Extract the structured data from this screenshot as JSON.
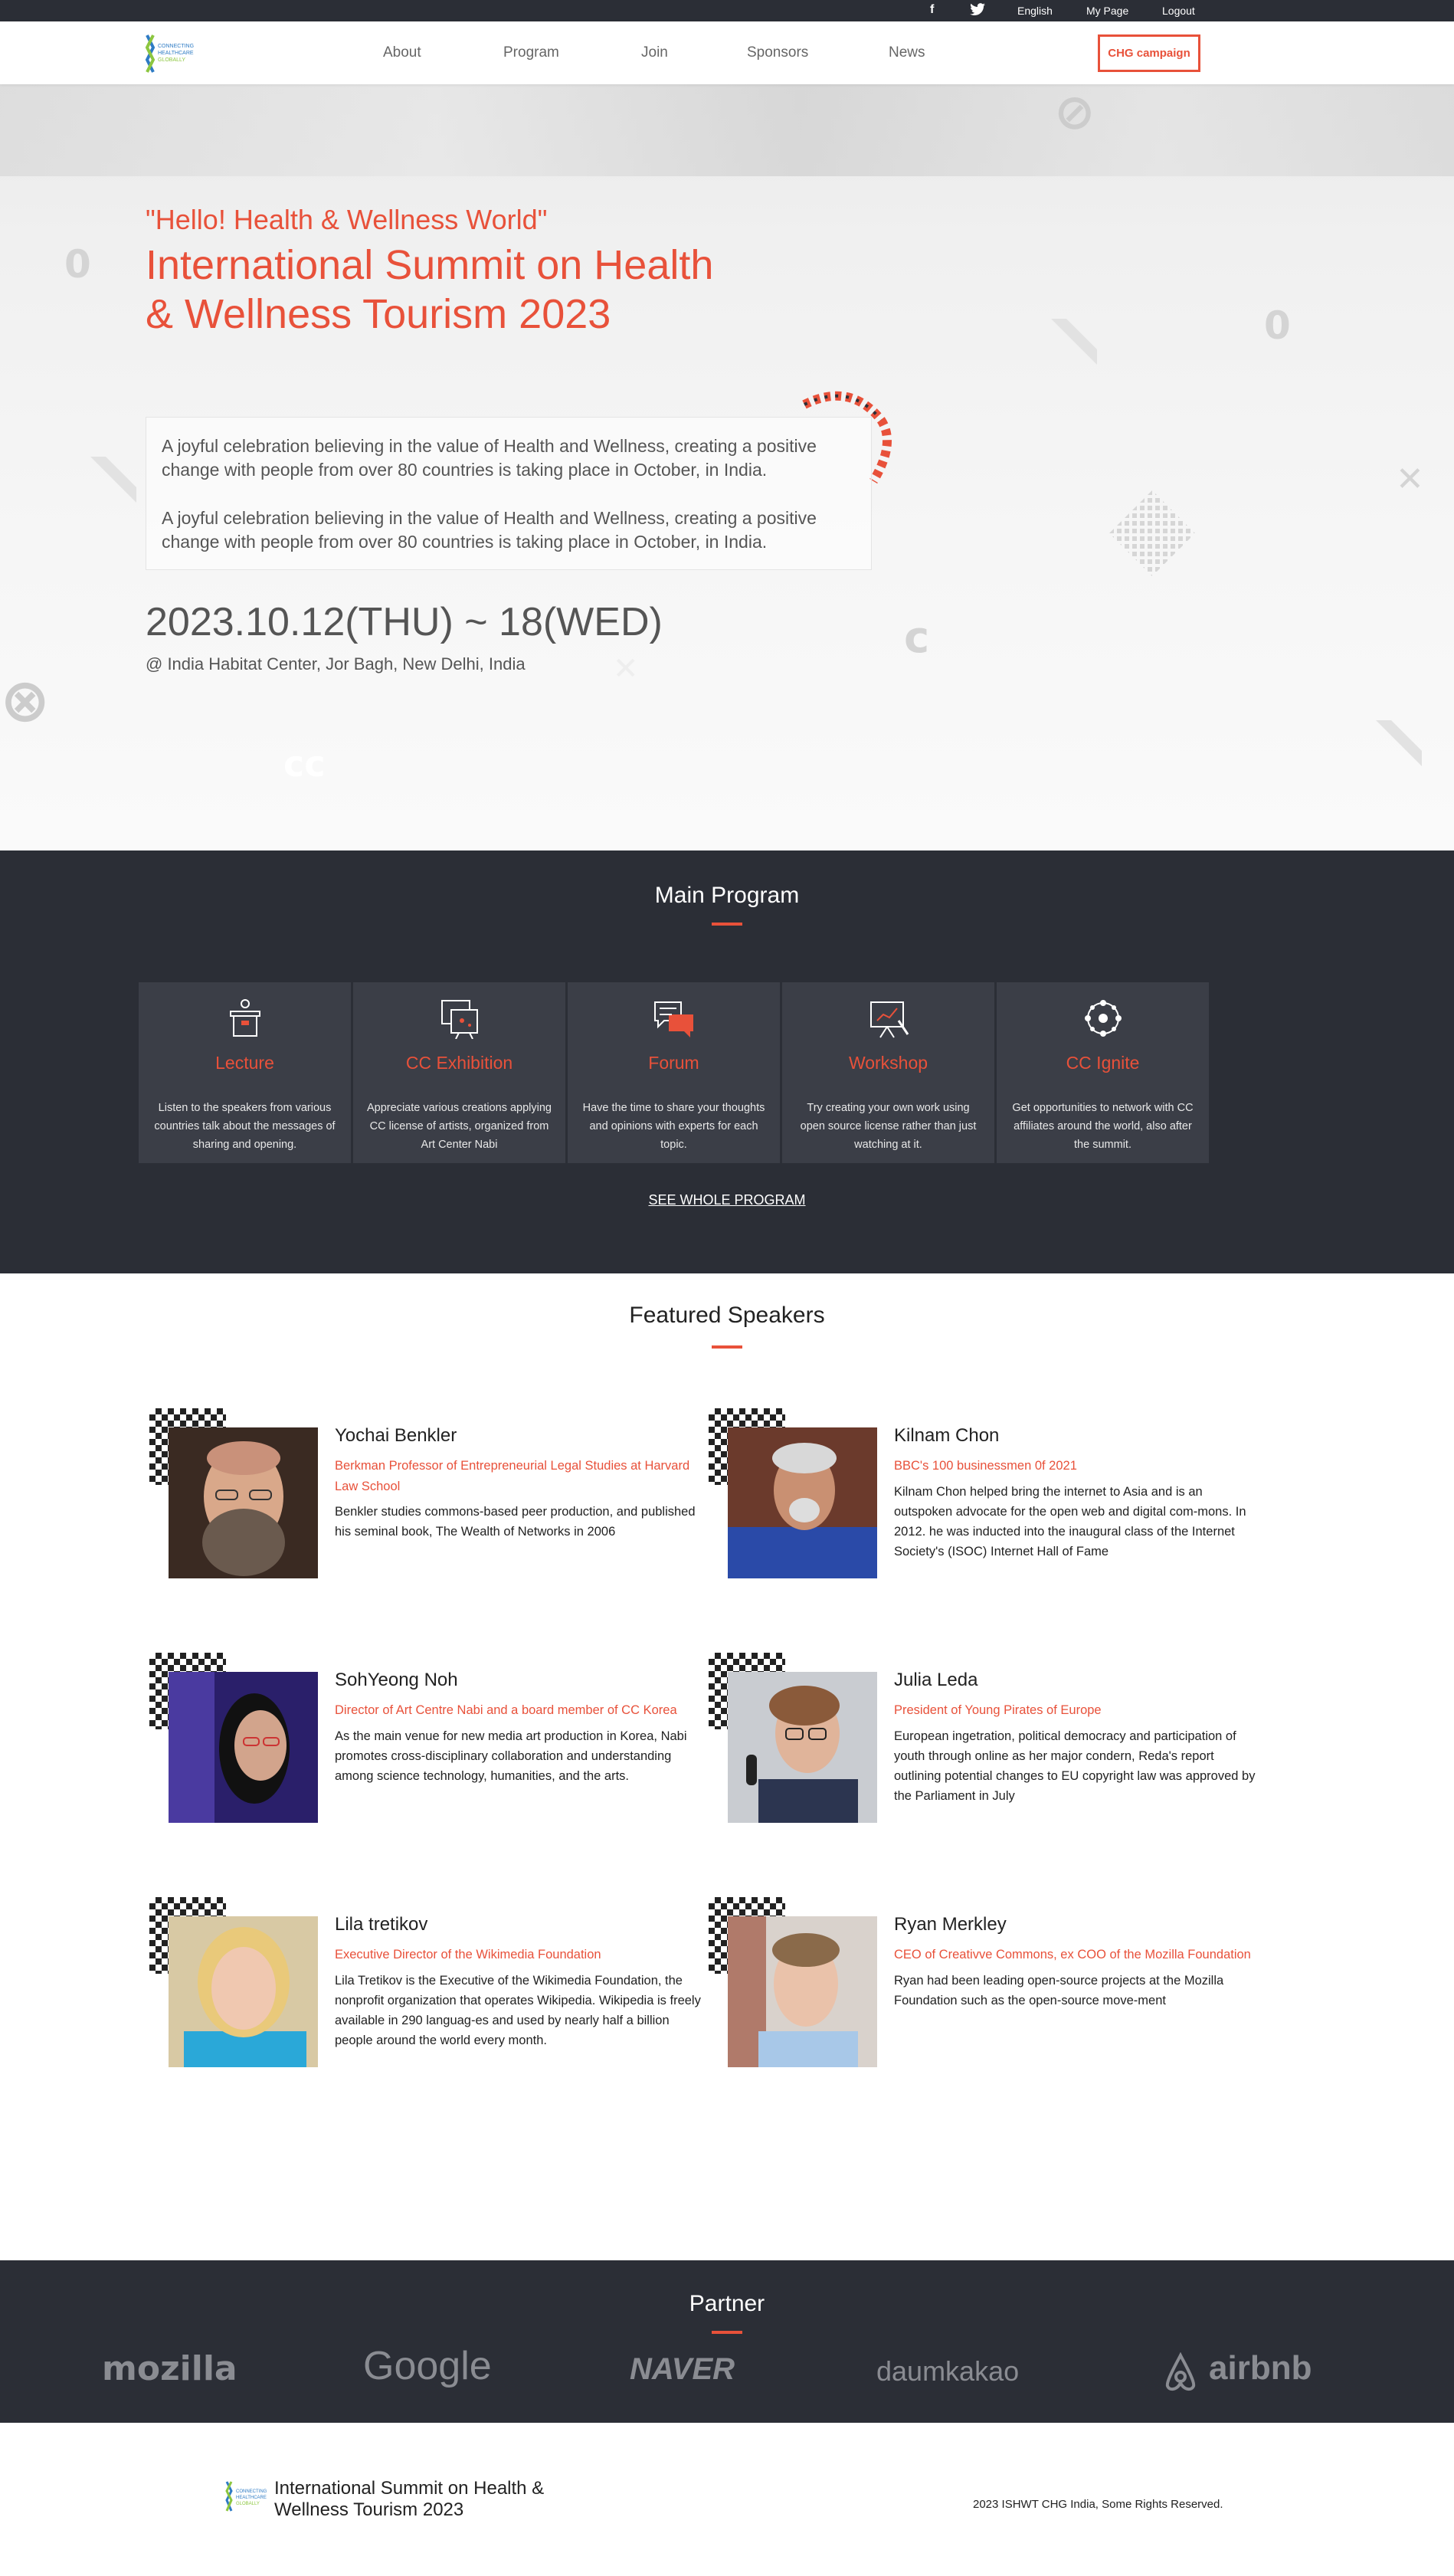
{
  "topbar": {
    "lang": "English",
    "mypage": "My Page",
    "logout": "Logout"
  },
  "nav": {
    "items": [
      "About",
      "Program",
      "Join",
      "Sponsors",
      "News"
    ],
    "campaign": "CHG campaign",
    "logo_text": [
      "CONNECTING",
      "HEALTHCARE",
      "GLOBALLY"
    ]
  },
  "hero": {
    "tagline": "\"Hello! Health & Wellness World\"",
    "title": "International Summit on Health & Wellness Tourism 2023",
    "desc1": "A joyful celebration believing in the value of Health and Wellness, creating a positive change with people from over 80 countries is taking place in October, in India.",
    "desc2": "A joyful celebration believing in the value of Health and Wellness, creating a positive change with people from over 80 countries is taking place in October, in India.",
    "date": "2023.10.12(THU) ~ 18(WED)",
    "venue": "@ India Habitat Center, Jor Bagh, New Delhi, India"
  },
  "main_program": {
    "title": "Main Program",
    "cards": [
      {
        "title": "Lecture",
        "desc": "Listen to the speakers from various countries talk about the messages of sharing and opening."
      },
      {
        "title": "CC Exhibition",
        "desc": "Appreciate various creations applying CC license of artists, organized from Art Center Nabi"
      },
      {
        "title": "Forum",
        "desc": "Have the time to share your thoughts and opinions with experts for each topic."
      },
      {
        "title": "Workshop",
        "desc": "Try creating your own work using open source license rather than just watching at it."
      },
      {
        "title": "CC Ignite",
        "desc": "Get opportunities to network with CC affiliates around the world, also after the summit."
      }
    ],
    "see_all": "SEE WHOLE PROGRAM"
  },
  "speakers": {
    "title": "Featured Speakers",
    "items": [
      {
        "name": "Yochai Benkler",
        "role": "Berkman Professor of Entrepreneurial Legal Studies at Harvard Law School",
        "bio": "Benkler studies commons-based peer production, and published his seminal book, The Wealth of Networks in 2006"
      },
      {
        "name": "Kilnam Chon",
        "role": "BBC's 100 businessmen 0f 2021",
        "bio": "Kilnam Chon helped bring the internet to Asia and is an outspoken advocate for the open web and digital com-mons. In 2012. he was inducted into the inaugural class of the Internet Society's (ISOC) Internet Hall of Fame"
      },
      {
        "name": "SohYeong Noh",
        "role": "Director of Art Centre Nabi and a board member of CC Korea",
        "bio": "As the main venue for new media art production in Korea, Nabi promotes cross-disciplinary collaboration and understanding among science technology, humanities, and the arts."
      },
      {
        "name": "Julia Leda",
        "role": "President of Young Pirates of Europe",
        "bio": "European ingetration, political democracy and participation of youth through online as her major condern, Reda's report outlining potential changes to EU copyright law was approved by the Parliament in July"
      },
      {
        "name": "Lila tretikov",
        "role": "Executive Director of the Wikimedia Foundation",
        "bio": "Lila Tretikov is the Executive of the Wikimedia Foundation, the nonprofit organization that operates Wikipedia. Wikipedia is freely available in 290 languag-es and used by nearly half a billion people around the world every month."
      },
      {
        "name": "Ryan Merkley",
        "role": "CEO of Creativve Commons, ex COO of the Mozilla Foundation",
        "bio": "Ryan had been leading open-source projects at the Mozilla Foundation such as the open-source move-ment"
      }
    ]
  },
  "partners": {
    "title": "Partner",
    "logos": [
      "mozilla",
      "Google",
      "NAVER",
      "daumkakao",
      "airbnb"
    ]
  },
  "footer": {
    "title": "International Summit on Health & Wellness Tourism 2023",
    "copyright": "2023 ISHWT CHG India, Some Rights Reserved."
  },
  "colors": {
    "accent": "#e8513a",
    "dark": "#2b2e36",
    "card": "#3b3e47"
  }
}
